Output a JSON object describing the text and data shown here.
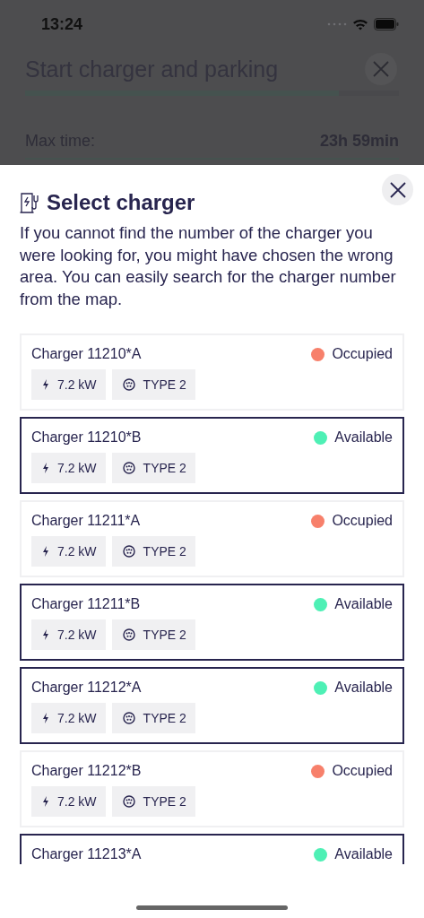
{
  "status_bar": {
    "time": "13:24"
  },
  "background": {
    "title": "Start charger and parking",
    "progress": {
      "level": 0.84
    },
    "max_time": {
      "label": "Max time:",
      "value": "23h 59min"
    }
  },
  "sheet": {
    "title": "Select charger",
    "description": "If you cannot find the number of the charger you were looking for, you might have chosen the wrong area. You can easily search for the charger number from the map.",
    "chargers": [
      {
        "name": "Charger 11210*A",
        "status": "Occupied",
        "color": "#f7806b",
        "selected": false,
        "specs": [
          "7.2 kW",
          "TYPE 2"
        ]
      },
      {
        "name": "Charger 11210*B",
        "status": "Available",
        "color": "#4ef0b5",
        "selected": true,
        "specs": [
          "7.2 kW",
          "TYPE 2"
        ]
      },
      {
        "name": "Charger 11211*A",
        "status": "Occupied",
        "color": "#f7806b",
        "selected": false,
        "specs": [
          "7.2 kW",
          "TYPE 2"
        ]
      },
      {
        "name": "Charger 11211*B",
        "status": "Available",
        "color": "#4ef0b5",
        "selected": true,
        "specs": [
          "7.2 kW",
          "TYPE 2"
        ]
      },
      {
        "name": "Charger 11212*A",
        "status": "Available",
        "color": "#4ef0b5",
        "selected": true,
        "specs": [
          "7.2 kW",
          "TYPE 2"
        ]
      },
      {
        "name": "Charger 11212*B",
        "status": "Occupied",
        "color": "#f7806b",
        "selected": false,
        "specs": [
          "7.2 kW",
          "TYPE 2"
        ]
      },
      {
        "name": "Charger 11213*A",
        "status": "Available",
        "color": "#4ef0b5",
        "selected": true
      }
    ]
  }
}
